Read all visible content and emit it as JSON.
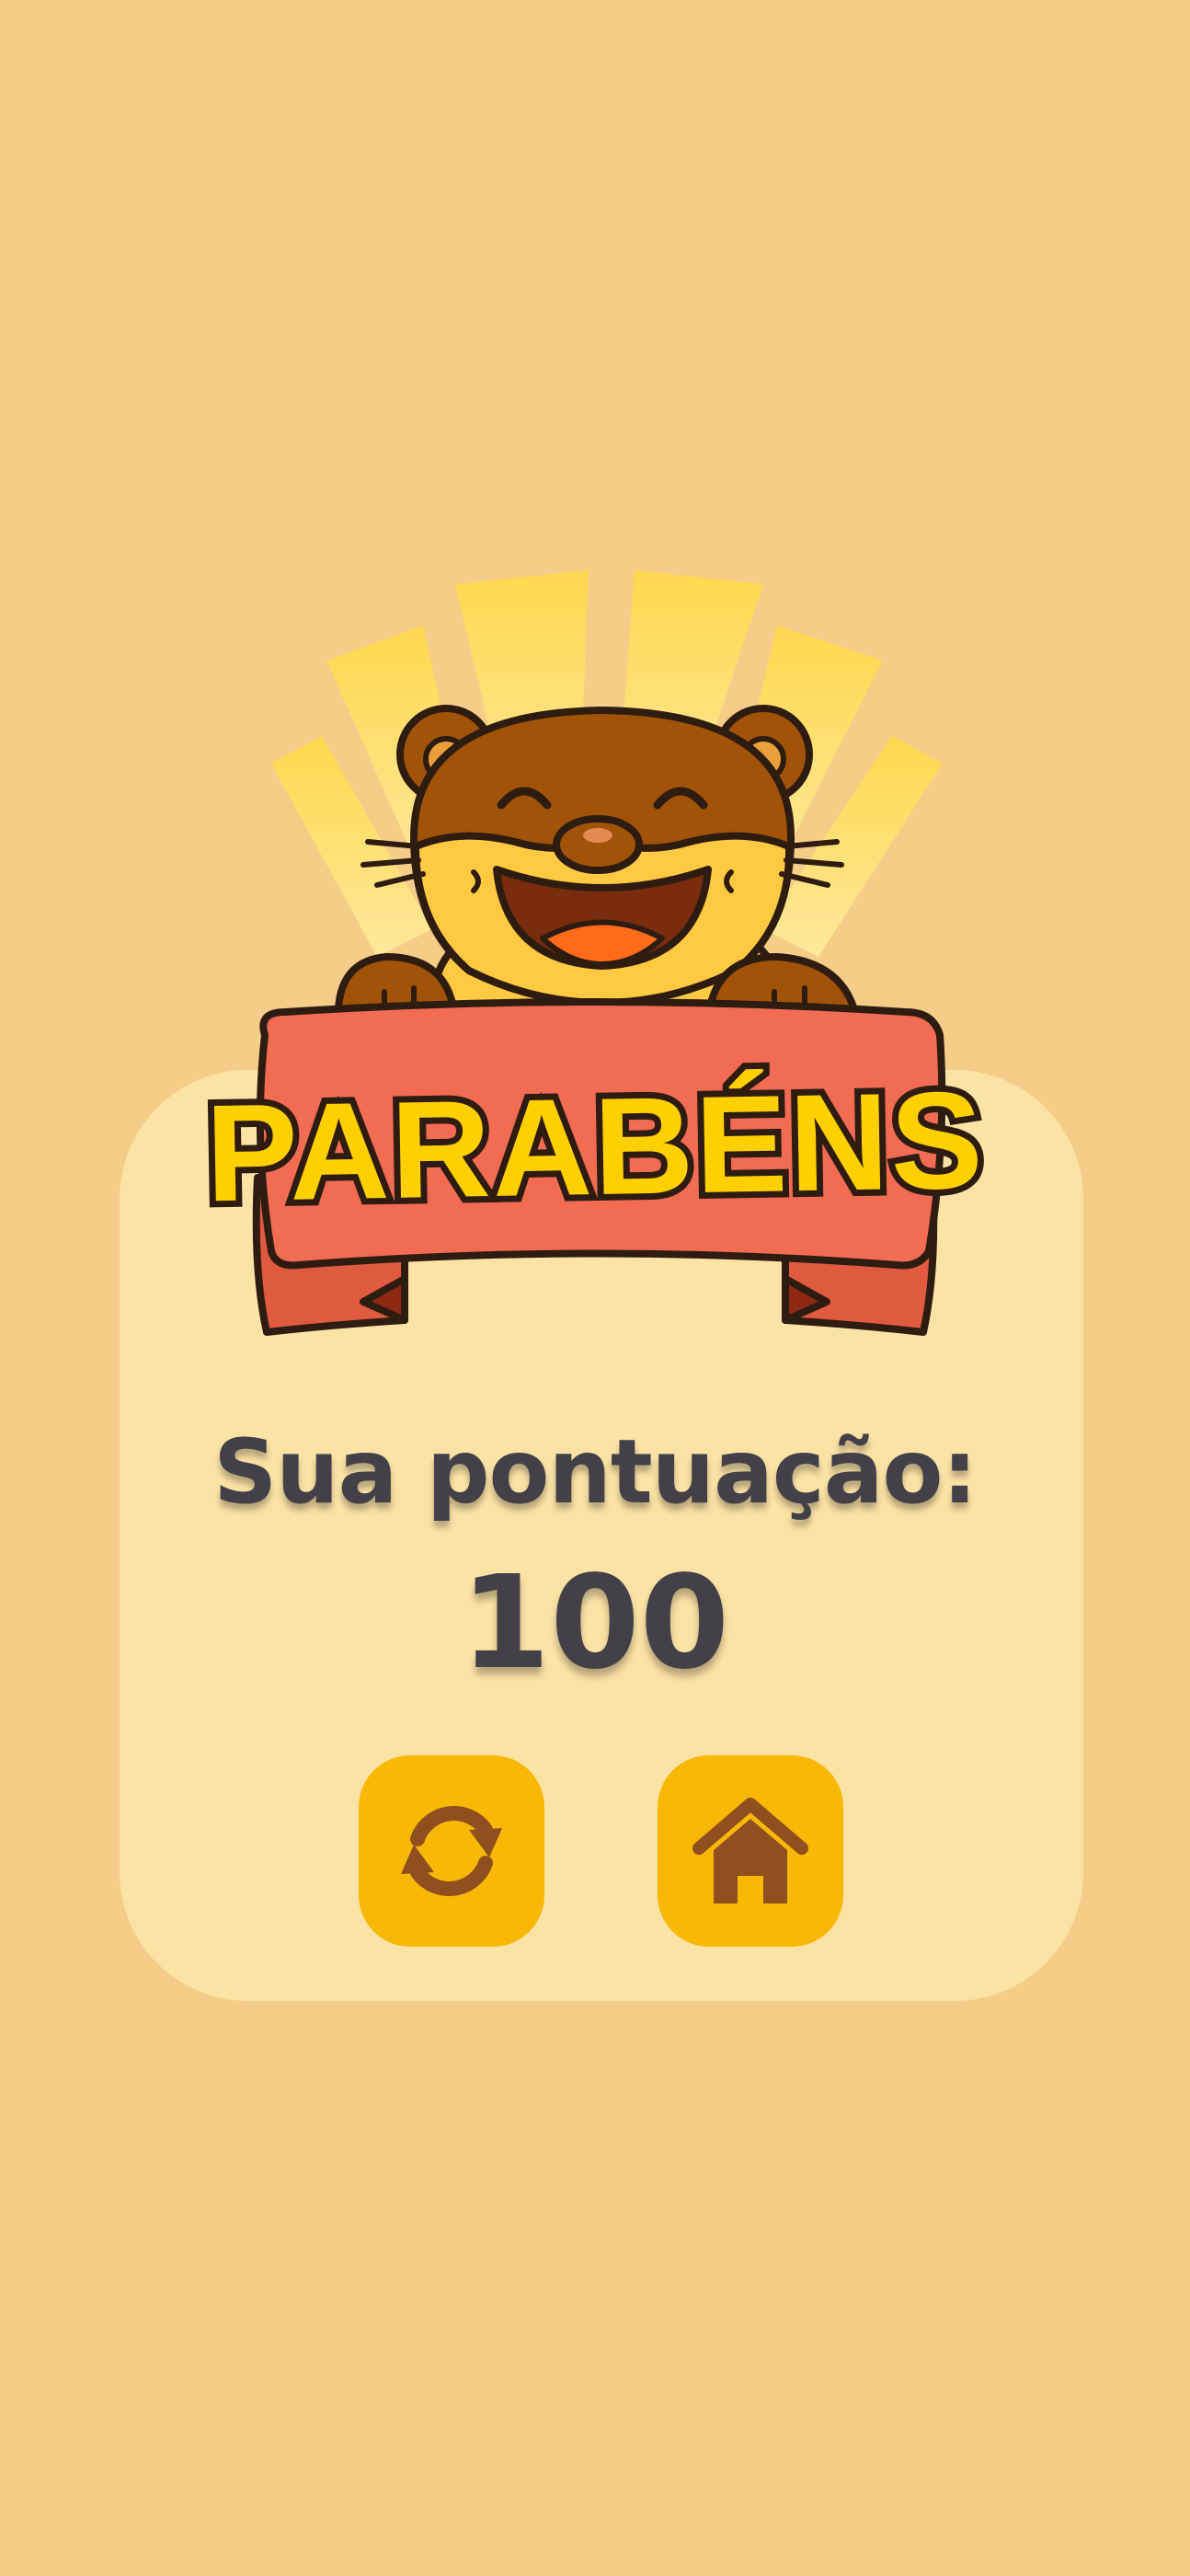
{
  "result": {
    "title": "PARABÉNS",
    "score_label": "Sua pontuação:",
    "score_value": "100"
  },
  "actions": {
    "restart_icon": "restart-arrows-icon",
    "home_icon": "home-icon"
  },
  "colors": {
    "background": "#F5CC88",
    "card": "#FBE3A6",
    "button": "#F9B806",
    "icon": "#8F4F1F",
    "text": "#434147",
    "banner": "#F26B53",
    "title_fill": "#FFD000",
    "outline": "#2F1C10",
    "bear": "#A15408"
  }
}
